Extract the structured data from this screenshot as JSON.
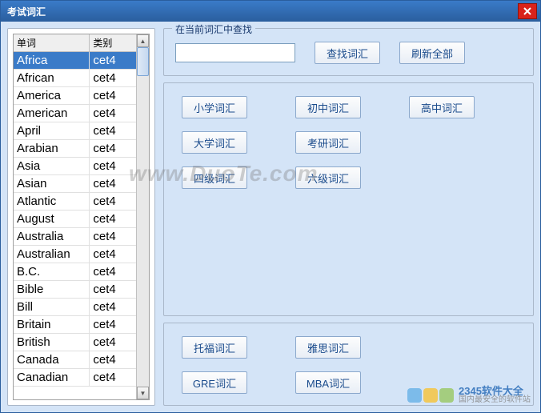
{
  "window": {
    "title": "考试词汇"
  },
  "table": {
    "headers": {
      "word": "单词",
      "category": "类别"
    },
    "rows": [
      {
        "word": "Africa",
        "category": "cet4",
        "selected": true
      },
      {
        "word": "African",
        "category": "cet4"
      },
      {
        "word": "America",
        "category": "cet4"
      },
      {
        "word": "American",
        "category": "cet4"
      },
      {
        "word": "April",
        "category": "cet4"
      },
      {
        "word": "Arabian",
        "category": "cet4"
      },
      {
        "word": "Asia",
        "category": "cet4"
      },
      {
        "word": "Asian",
        "category": "cet4"
      },
      {
        "word": "Atlantic",
        "category": "cet4"
      },
      {
        "word": "August",
        "category": "cet4"
      },
      {
        "word": "Australia",
        "category": "cet4"
      },
      {
        "word": "Australian",
        "category": "cet4"
      },
      {
        "word": "B.C.",
        "category": "cet4"
      },
      {
        "word": "Bible",
        "category": "cet4"
      },
      {
        "word": "Bill",
        "category": "cet4"
      },
      {
        "word": "Britain",
        "category": "cet4"
      },
      {
        "word": "British",
        "category": "cet4"
      },
      {
        "word": "Canada",
        "category": "cet4"
      },
      {
        "word": "Canadian",
        "category": "cet4"
      }
    ]
  },
  "search": {
    "group_label": "在当前词汇中查找",
    "input_value": "",
    "find_label": "查找词汇",
    "refresh_label": "刷新全部"
  },
  "categories": {
    "primary": "小学词汇",
    "junior": "初中词汇",
    "senior": "高中词汇",
    "college": "大学词汇",
    "postgrad": "考研词汇",
    "cet4": "四级词汇",
    "cet6": "六级词汇"
  },
  "exams": {
    "toefl": "托福词汇",
    "ielts": "雅思词汇",
    "gre": "GRE词汇",
    "mba": "MBA词汇"
  },
  "branding": {
    "watermark": "www.DuoTe.com",
    "name": "2345软件大全",
    "tagline": "国内最安全的软件站"
  }
}
